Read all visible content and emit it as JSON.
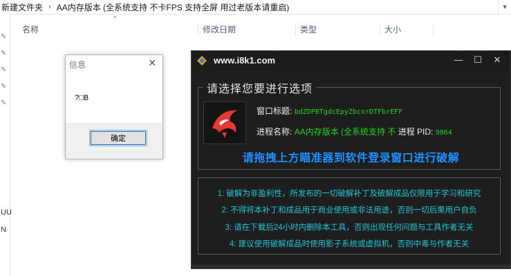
{
  "explorer": {
    "breadcrumb": [
      "新建文件夹",
      "AA内存版本 (全系统支持 不卡FPS 支持全屏 用过老版本请重启)"
    ],
    "separator": "›",
    "columns": [
      "名称",
      "修改日期",
      "类型",
      "大小"
    ],
    "left_strip_text": [
      "UU",
      "N"
    ]
  },
  "msgbox": {
    "title": "信息",
    "close": "✕",
    "message": "?□B",
    "ok_label": "确定"
  },
  "tool": {
    "title": "www.i8k1.com",
    "min": "—",
    "max": "☐",
    "close": "✕",
    "group_label": "请选择您要进行选项",
    "window_title_label": "窗口标题:",
    "window_title_value": "bdZDPBTgdcEpyZbcxrDTFbrEFF",
    "process_name_label": "进程名称:",
    "process_name_value": "AA内存版本 (全系统支持 不",
    "pid_label": "进程 PID:",
    "pid_value": "9864",
    "drag_msg": "请拖拽上方瞄准器到软件登录窗口进行破解",
    "notices": [
      "1: 破解为非盈利性，所发布的一切破解补丁及破解成品仅限用于学习和研究",
      "2: 不得将本补丁和成品用于商业使用或非法用途，否则一切后果用户自负",
      "3: 请在下载后24小时内删除本工具，否则出现任何问题与工具作者无关",
      "4: 建议使用破解成品时使用影子系统或虚拟机，否则中毒与作者无关"
    ],
    "colors": {
      "green": "#22d322",
      "blue": "#1e90ff",
      "cyan": "#22c6d6",
      "bg": "#1e1e1e"
    }
  }
}
